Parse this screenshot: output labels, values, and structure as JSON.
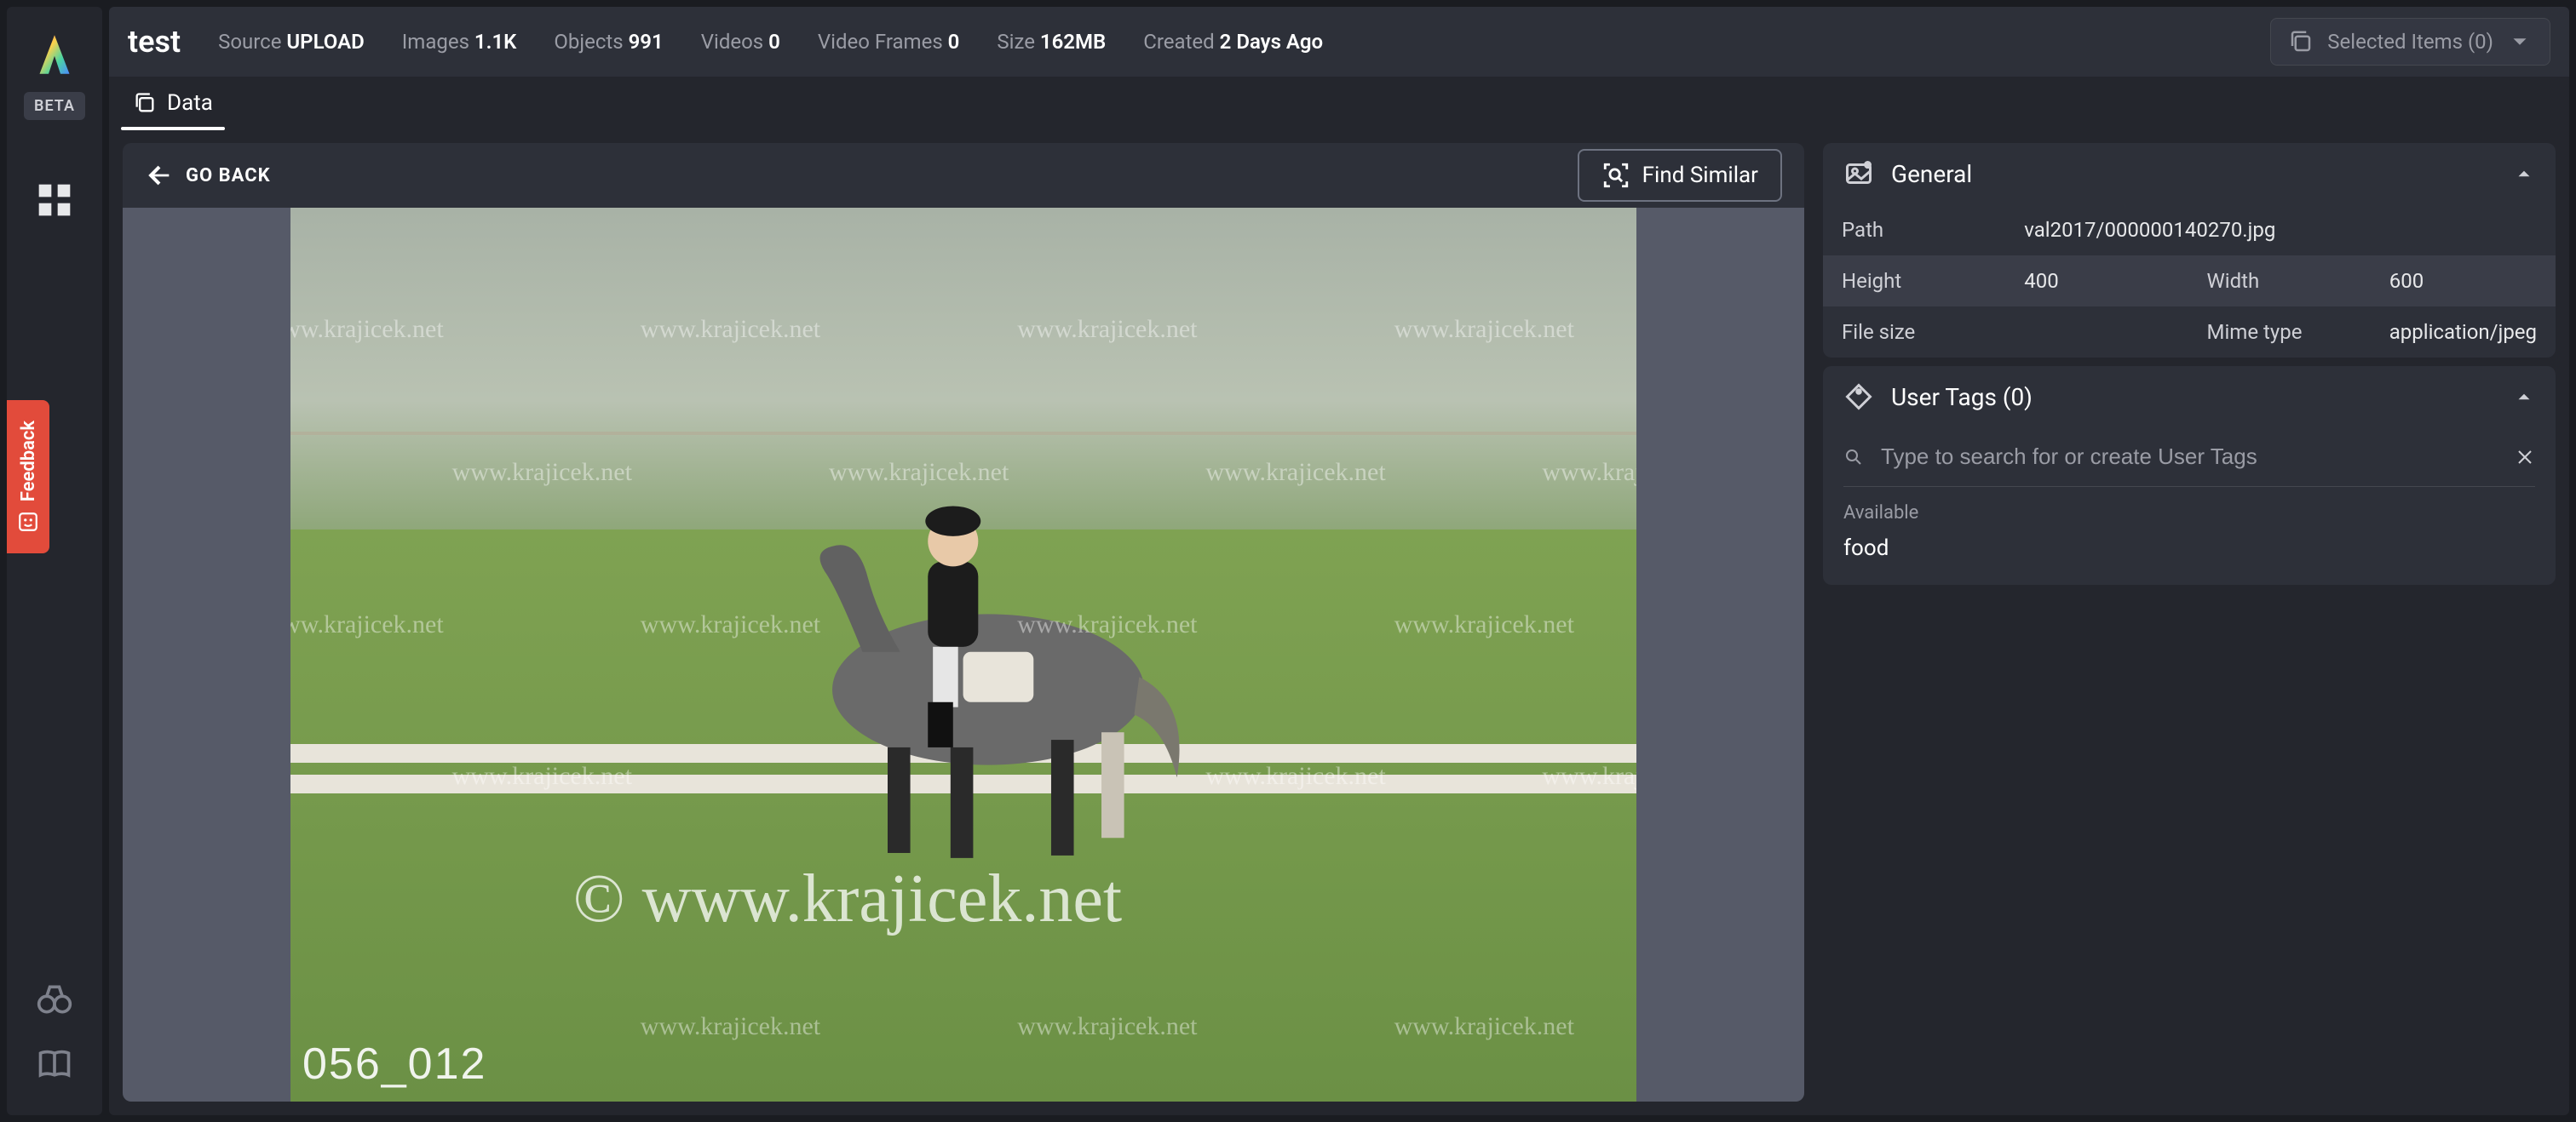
{
  "leftRail": {
    "betaLabel": "BETA"
  },
  "feedback": {
    "label": "Feedback"
  },
  "dataset": {
    "name": "test",
    "stats": {
      "sourceLabel": "Source",
      "sourceValue": "UPLOAD",
      "imagesLabel": "Images",
      "imagesValue": "1.1K",
      "objectsLabel": "Objects",
      "objectsValue": "991",
      "videosLabel": "Videos",
      "videosValue": "0",
      "videoFramesLabel": "Video Frames",
      "videoFramesValue": "0",
      "sizeLabel": "Size",
      "sizeValue": "162MB",
      "createdLabel": "Created",
      "createdValue": "2 Days Ago"
    }
  },
  "selected": {
    "label": "Selected Items (0)"
  },
  "tabs": {
    "data": "Data"
  },
  "imagePanel": {
    "goBack": "GO BACK",
    "findSimilar": "Find Similar",
    "watermark": "www.krajicek.net",
    "bigWatermark": "© www.krajicek.net",
    "frameId": "056_012"
  },
  "general": {
    "title": "General",
    "pathLabel": "Path",
    "pathValue": "val2017/000000140270.jpg",
    "heightLabel": "Height",
    "heightValue": "400",
    "widthLabel": "Width",
    "widthValue": "600",
    "fileSizeLabel": "File size",
    "fileSizeValue": "",
    "mimeLabel": "Mime type",
    "mimeValue": "application/jpeg"
  },
  "userTags": {
    "title": "User Tags (0)",
    "placeholder": "Type to search for or create User Tags",
    "availableLabel": "Available",
    "items": [
      "food"
    ]
  }
}
